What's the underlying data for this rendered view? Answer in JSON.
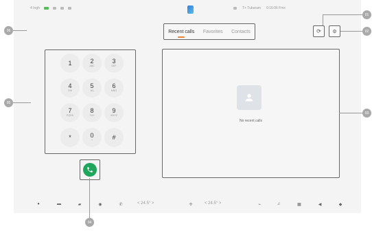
{
  "status_bar": {
    "left_text": [
      "4 Ingh",
      "RGG"
    ],
    "right_text": [
      "T+ Tubaram",
      "0:16:06 Fmx"
    ]
  },
  "tabs": [
    {
      "label": "Recent calls",
      "active": true
    },
    {
      "label": "Favorites",
      "active": false
    },
    {
      "label": "Contacts",
      "active": false
    }
  ],
  "toolbar_icons": [
    {
      "name": "sync-icon",
      "glyph": "⟳"
    },
    {
      "name": "settings-icon",
      "glyph": "✹"
    }
  ],
  "dialpad": {
    "keys": [
      {
        "digit": "1",
        "letters": ""
      },
      {
        "digit": "2",
        "letters": "ABC"
      },
      {
        "digit": "3",
        "letters": "DEF"
      },
      {
        "digit": "4",
        "letters": "GHI"
      },
      {
        "digit": "5",
        "letters": "JKL"
      },
      {
        "digit": "6",
        "letters": "MNO"
      },
      {
        "digit": "7",
        "letters": "PQRS"
      },
      {
        "digit": "8",
        "letters": "TUV"
      },
      {
        "digit": "9",
        "letters": "WXYZ"
      },
      {
        "digit": "*",
        "letters": ""
      },
      {
        "digit": "0",
        "letters": "+"
      },
      {
        "digit": "#",
        "letters": ""
      }
    ]
  },
  "call_button": {
    "color": "#1fa55c"
  },
  "recent_calls": {
    "empty_text": "No recent calls"
  },
  "dock": {
    "temp_left": "24.5°",
    "temp_right": "24.5°",
    "icons": [
      "car-icon",
      "car-front-icon",
      "car-rear-icon",
      "media-icon",
      "phone-icon",
      "fan-icon",
      "wiper-icon",
      "music-icon",
      "apps-icon",
      "speaker-icon"
    ]
  },
  "callouts": [
    "01",
    "02",
    "03",
    "04",
    "05",
    "06"
  ],
  "colors": {
    "accent": "#e8833a",
    "call_green": "#1fa55c"
  }
}
